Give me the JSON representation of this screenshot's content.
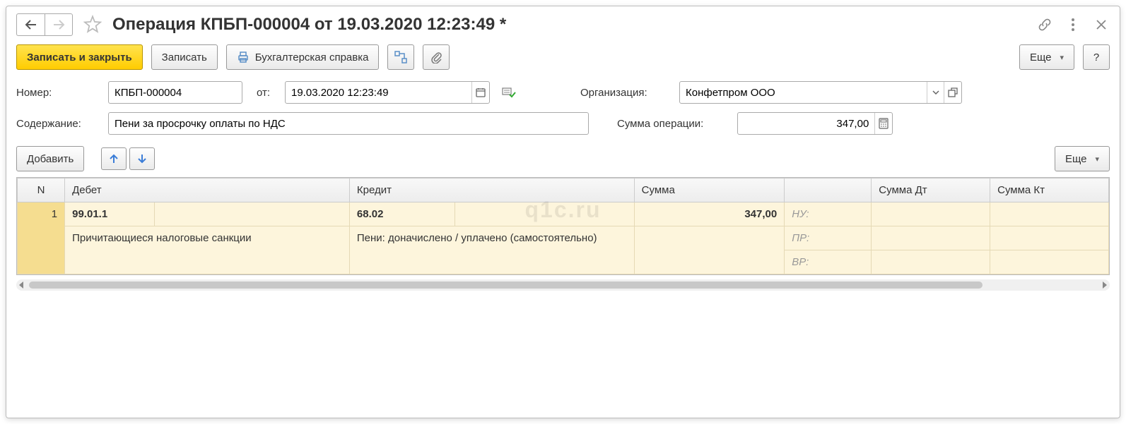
{
  "header": {
    "title": "Операция КПБП-000004 от 19.03.2020 12:23:49 *"
  },
  "toolbar": {
    "save_close": "Записать и закрыть",
    "save": "Записать",
    "accounting_ref": "Бухгалтерская справка",
    "more": "Еще",
    "help": "?"
  },
  "form": {
    "number_label": "Номер:",
    "number_value": "КПБП-000004",
    "date_label": "от:",
    "date_value": "19.03.2020 12:23:49",
    "org_label": "Организация:",
    "org_value": "Конфетпром ООО",
    "content_label": "Содержание:",
    "content_value": "Пени за просрочку оплаты по НДС",
    "sum_label": "Сумма операции:",
    "sum_value": "347,00"
  },
  "table_toolbar": {
    "add": "Добавить",
    "more": "Еще"
  },
  "table": {
    "headers": {
      "n": "N",
      "debit": "Дебет",
      "credit": "Кредит",
      "sum": "Сумма",
      "sum_dt": "Сумма Дт",
      "sum_kt": "Сумма Кт"
    },
    "rows": [
      {
        "n": "1",
        "debit_account": "99.01.1",
        "debit_desc": "Причитающиеся налоговые санкции",
        "credit_account": "68.02",
        "credit_desc": "Пени: доначислено / уплачено (самостоятельно)",
        "sum": "347,00",
        "tags": [
          "НУ:",
          "ПР:",
          "ВР:"
        ]
      }
    ]
  },
  "watermark": "q1c.ru"
}
